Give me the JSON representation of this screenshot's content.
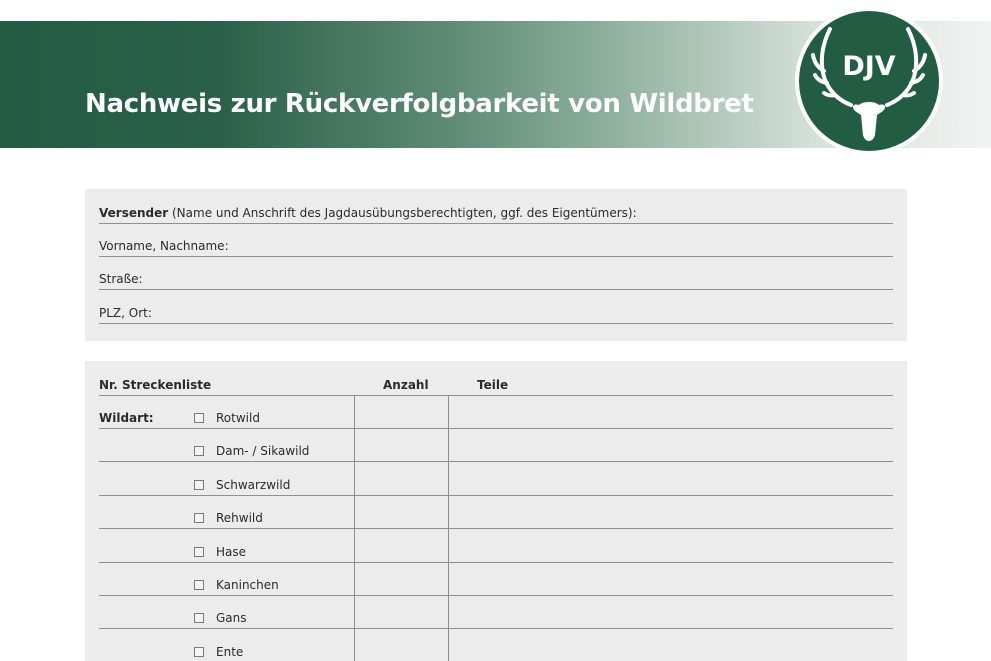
{
  "header": {
    "title": "Nachweis zur Rückverfolgbarkeit von Wildbret",
    "logo_text": "DJV"
  },
  "colors": {
    "brand_green": "#225c43",
    "panel_gray": "#ececec",
    "rule_gray": "#8f8f8f"
  },
  "sender": {
    "label_bold": "Versender",
    "label_rest": " (Name und Anschrift des Jagdausübungsberechtigten, ggf. des Eigentümers):",
    "name_label": "Vorname, Nachname:",
    "street_label": "Straße:",
    "city_label": "PLZ, Ort:"
  },
  "game_table": {
    "col_list_no": "Nr. Streckenliste",
    "col_count": "Anzahl",
    "col_parts": "Teile",
    "row_label": "Wildart:",
    "species": [
      {
        "name": "Rotwild",
        "checked": false
      },
      {
        "name": "Dam- / Sikawild",
        "checked": false
      },
      {
        "name": "Schwarzwild",
        "checked": false
      },
      {
        "name": "Rehwild",
        "checked": false
      },
      {
        "name": "Hase",
        "checked": false
      },
      {
        "name": "Kaninchen",
        "checked": false
      },
      {
        "name": "Gans",
        "checked": false
      },
      {
        "name": "Ente",
        "checked": false
      }
    ]
  }
}
